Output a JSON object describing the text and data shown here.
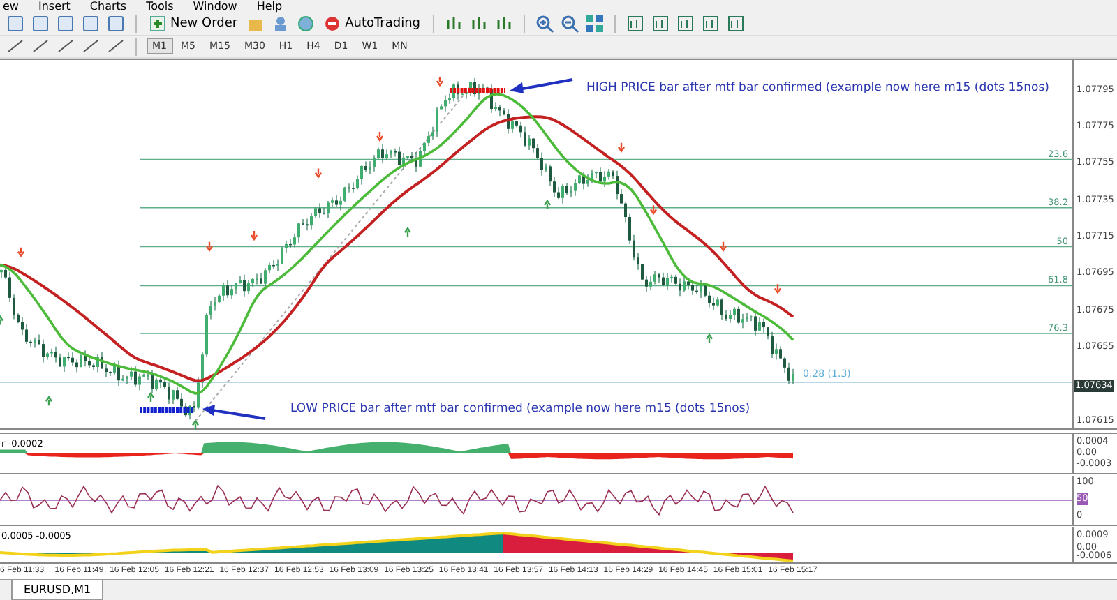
{
  "menu": [
    "ew",
    "Insert",
    "Charts",
    "Tools",
    "Window",
    "Help"
  ],
  "toolbar": {
    "buttons": [
      {
        "label": "New Order"
      },
      {
        "label": "AutoTrading"
      }
    ]
  },
  "timeframes": [
    {
      "label": "M1",
      "selected": true
    },
    {
      "label": "M5",
      "selected": false
    },
    {
      "label": "M15",
      "selected": false
    },
    {
      "label": "M30",
      "selected": false
    },
    {
      "label": "H1",
      "selected": false
    },
    {
      "label": "H4",
      "selected": false
    },
    {
      "label": "D1",
      "selected": false
    },
    {
      "label": "W1",
      "selected": false
    },
    {
      "label": "MN",
      "selected": false
    }
  ],
  "main_chart": {
    "annotations": [
      "HIGH PRICE bar after mtf bar confirmed (example now here m15 (dots 15nos)",
      "LOW PRICE bar after mtf bar confirmed (example now here m15 (dots 15nos)"
    ],
    "fib_levels": [
      "23.6",
      "38.2",
      "50",
      "61.8",
      "76.3"
    ],
    "range_label": "0.28 (1.3)",
    "price_axis": [
      {
        "label": "1.07795",
        "current": false
      },
      {
        "label": "1.07775",
        "current": false
      },
      {
        "label": "1.07755",
        "current": false
      },
      {
        "label": "1.07735",
        "current": false
      },
      {
        "label": "1.07715",
        "current": false
      },
      {
        "label": "1.07695",
        "current": false
      },
      {
        "label": "1.07675",
        "current": false
      },
      {
        "label": "1.07655",
        "current": false
      },
      {
        "label": "1.07634",
        "current": true
      },
      {
        "label": "1.07615",
        "current": false
      }
    ]
  },
  "indicator_1": {
    "label": "r -0.0002",
    "axis": [
      "0.0004",
      "0.00",
      "-0.0003"
    ]
  },
  "indicator_2": {
    "axis": [
      "100",
      "0"
    ],
    "level_label": "50"
  },
  "indicator_3": {
    "label": "0.0005 -0.0005",
    "axis": [
      "0.0009",
      "0.00",
      "-0.0006"
    ]
  },
  "time_axis": [
    "6 Feb 11:33",
    "16 Feb 11:49",
    "16 Feb 12:05",
    "16 Feb 12:21",
    "16 Feb 12:37",
    "16 Feb 12:53",
    "16 Feb 13:09",
    "16 Feb 13:25",
    "16 Feb 13:41",
    "16 Feb 13:57",
    "16 Feb 14:13",
    "16 Feb 14:29",
    "16 Feb 14:45",
    "16 Feb 15:01",
    "16 Feb 15:17"
  ],
  "tabs": [
    {
      "label": "EURUSD,M1",
      "selected": true
    }
  ]
}
